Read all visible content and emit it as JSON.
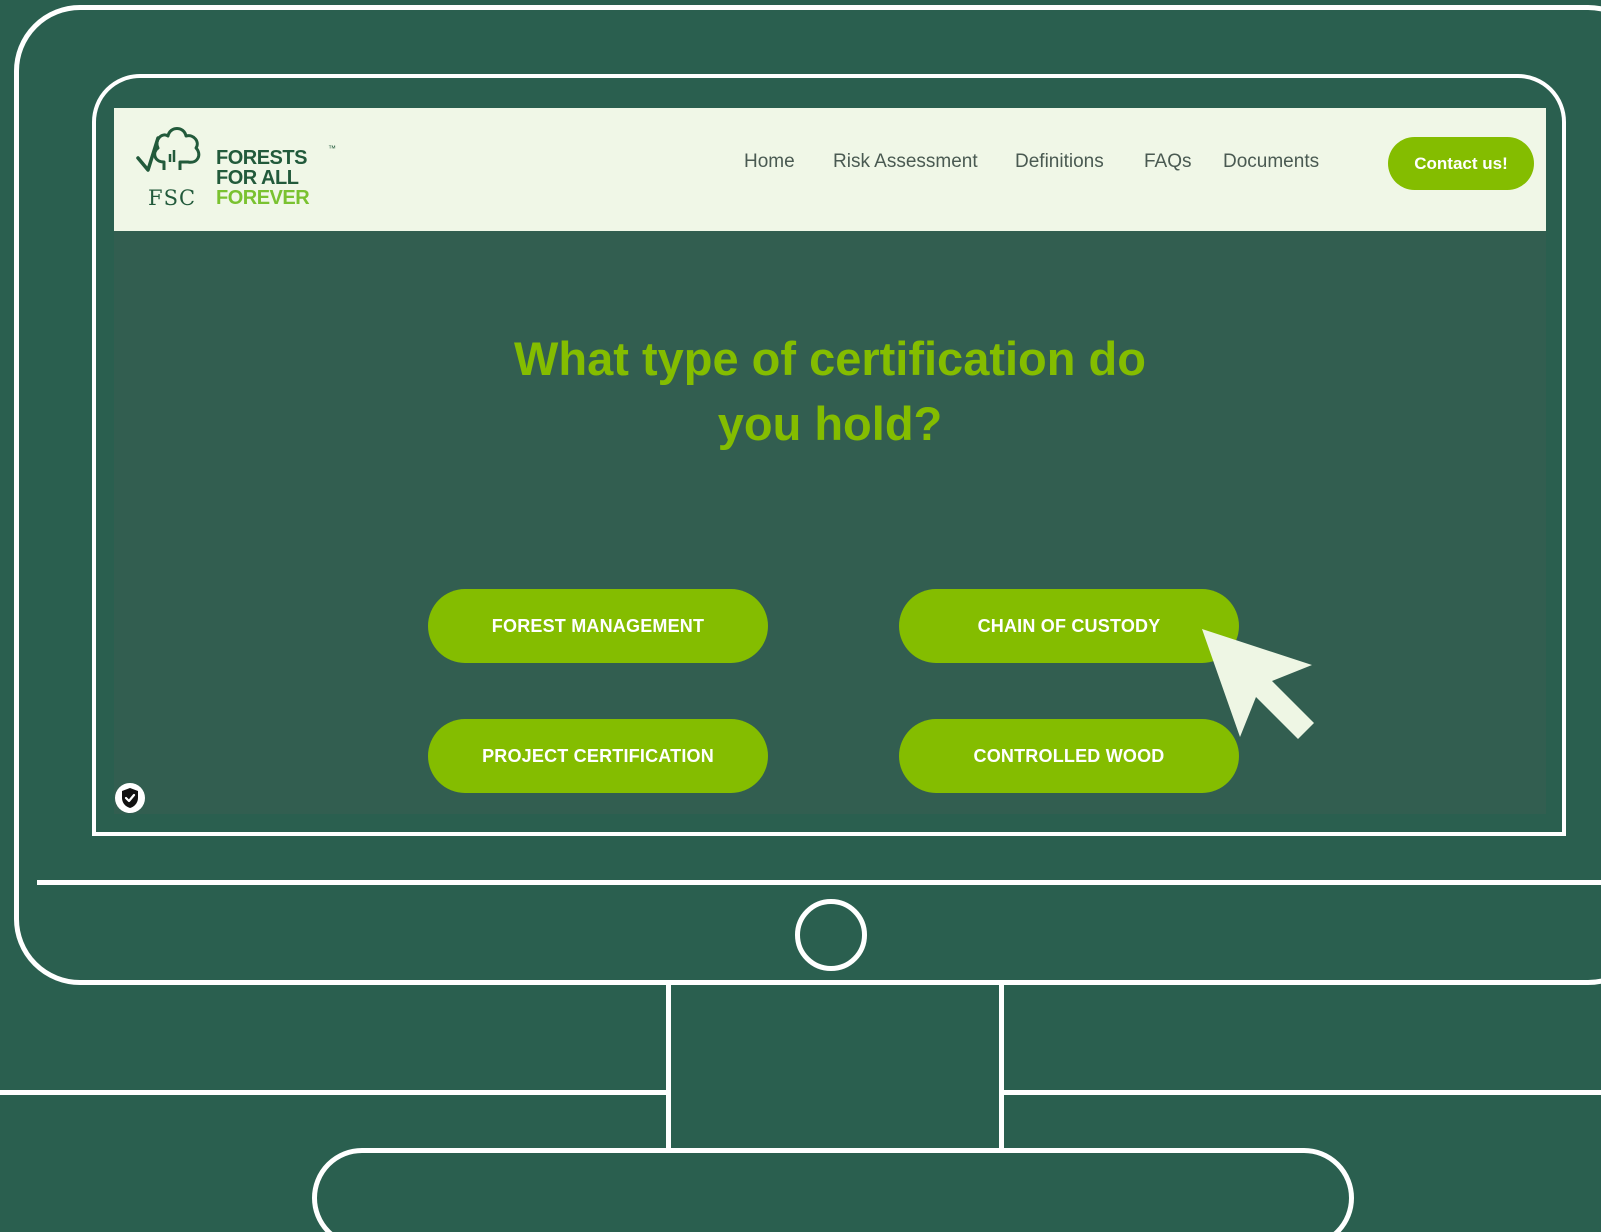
{
  "logo": {
    "fsc_text": "FSC",
    "line1": "FORESTS",
    "line2": "FOR ALL",
    "line3": "FOREVER",
    "trademark": "™",
    "icon": "tree-checkmark-icon"
  },
  "nav": {
    "items": [
      {
        "label": "Home"
      },
      {
        "label": "Risk Assessment"
      },
      {
        "label": "Definitions"
      },
      {
        "label": "FAQs"
      },
      {
        "label": "Documents"
      }
    ],
    "contact_label": "Contact us!"
  },
  "main": {
    "heading_line1": "What type of certification do",
    "heading_line2": "you hold?",
    "options": [
      {
        "label": "FOREST MANAGEMENT"
      },
      {
        "label": "CHAIN OF CUSTODY"
      },
      {
        "label": "PROJECT CERTIFICATION"
      },
      {
        "label": "CONTROLLED WOOD"
      }
    ]
  },
  "icons": {
    "privacy_badge": "shield-check-icon",
    "pointer": "mouse-cursor-icon"
  },
  "colors": {
    "background": "#2a5f4f",
    "screen_background": "#325e50",
    "header_background": "#f0f7e7",
    "accent_green": "#84bd00",
    "logo_dark_green": "#225a3b",
    "outline": "#ffffff"
  }
}
